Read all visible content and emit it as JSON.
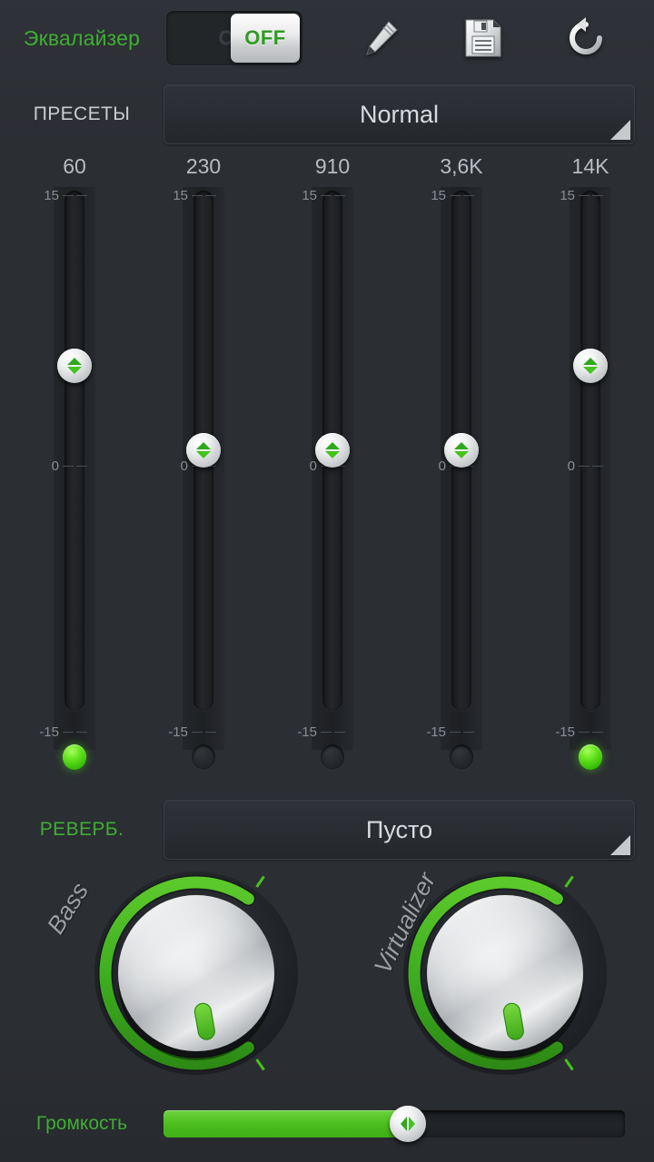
{
  "header": {
    "title": "Эквалайзер",
    "toggle": {
      "on_label": "ON",
      "off_label": "OFF",
      "state": "OFF"
    },
    "icons": [
      {
        "name": "pencil-icon",
        "label": "Edit"
      },
      {
        "name": "floppy-save-icon",
        "label": "Save"
      },
      {
        "name": "reset-undo-icon",
        "label": "Reset"
      }
    ]
  },
  "presets": {
    "label": "ПРЕСЕТЫ",
    "value": "Normal"
  },
  "reverb": {
    "label": "РЕВЕРБ.",
    "value": "Пусто"
  },
  "equalizer": {
    "scale": {
      "top": "15",
      "mid": "0",
      "bottom": "-15"
    },
    "bands": [
      {
        "freq": "60",
        "value": 5,
        "led": "on"
      },
      {
        "freq": "230",
        "value": 0,
        "led": "off"
      },
      {
        "freq": "910",
        "value": 0,
        "led": "off"
      },
      {
        "freq": "3,6K",
        "value": 0,
        "led": "off"
      },
      {
        "freq": "14K",
        "value": 5,
        "led": "on"
      }
    ]
  },
  "knobs": [
    {
      "name": "bass-knob",
      "label": "Bass",
      "value": 18
    },
    {
      "name": "virtualizer-knob",
      "label": "Virtualizer",
      "value": 18
    }
  ],
  "volume": {
    "label": "Громкость",
    "percent": 53
  },
  "colors": {
    "accent_green": "#3fae33",
    "led_green": "#4cc31a",
    "background": "#2b2e33",
    "text_grey": "#c9ccd0"
  }
}
